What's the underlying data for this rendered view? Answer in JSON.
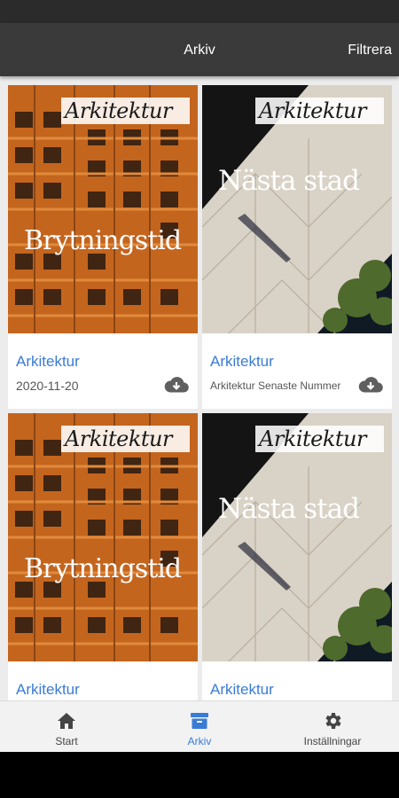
{
  "app_bar": {
    "title": "Arkiv",
    "filter_label": "Filtrera"
  },
  "issues": [
    {
      "title": "Arkitektur",
      "subtitle": "2020-11-20",
      "cover_masthead": "Arkitektur",
      "cover_headline": "Brytningstid",
      "icon": "cloud-download-icon"
    },
    {
      "title": "Arkitektur",
      "subtitle": "Arkitektur Senaste Nummer",
      "cover_masthead": "Arkitektur",
      "cover_headline": "Nästa stad",
      "icon": "cloud-download-icon"
    },
    {
      "title": "Arkitektur",
      "subtitle": "",
      "cover_masthead": "Arkitektur",
      "cover_headline": "Brytningstid",
      "icon": "cloud-download-icon"
    },
    {
      "title": "Arkitektur",
      "subtitle": "",
      "cover_masthead": "Arkitektur",
      "cover_headline": "Nästa stad",
      "icon": "cloud-download-icon"
    }
  ],
  "bottom_nav": {
    "items": [
      {
        "label": "Start",
        "icon": "home-icon"
      },
      {
        "label": "Arkiv",
        "icon": "archive-icon",
        "active": true
      },
      {
        "label": "Inställningar",
        "icon": "gear-icon"
      }
    ]
  },
  "colors": {
    "accent": "#3a7bd5",
    "app_bar": "#3a3a3a",
    "status_bar": "#2b2b2b"
  }
}
